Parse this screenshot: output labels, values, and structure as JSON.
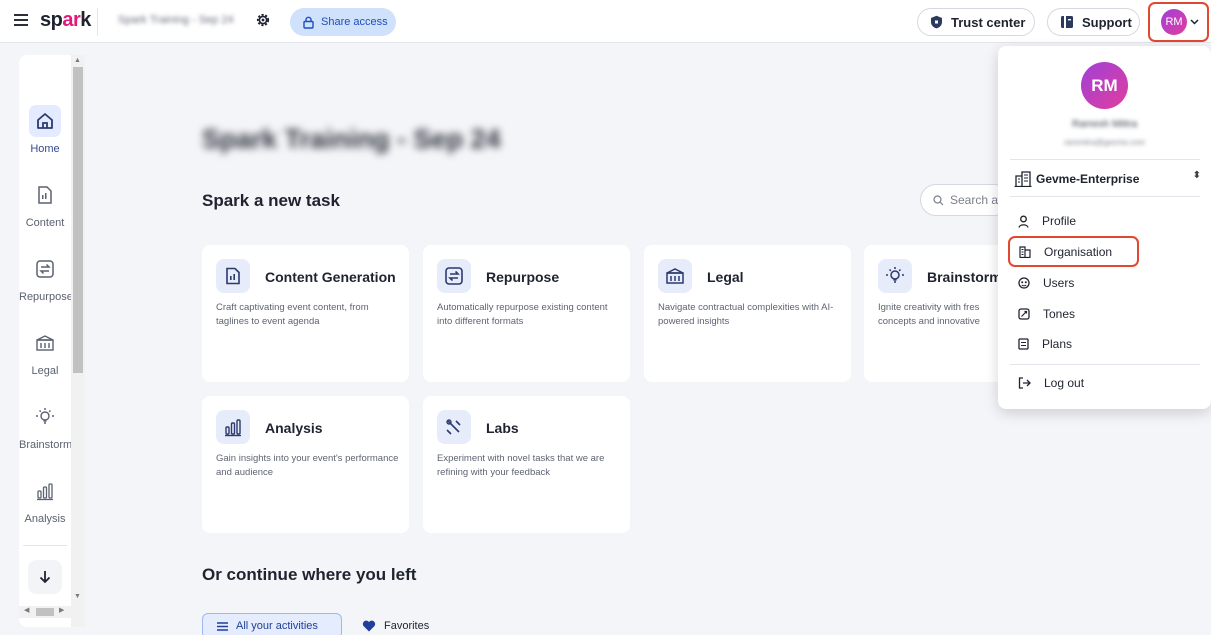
{
  "topbar": {
    "logo_a": "sp",
    "logo_b": "ar",
    "logo_c": "k",
    "project_title": "Spark Training - Sep 24",
    "share_label": "Share access",
    "trust_label": "Trust center",
    "support_label": "Support",
    "avatar_initials": "RM"
  },
  "sidebar": {
    "items": [
      {
        "label": "Home",
        "icon": "home-icon"
      },
      {
        "label": "Content",
        "icon": "document-icon"
      },
      {
        "label": "Repurpose",
        "icon": "repurpose-icon"
      },
      {
        "label": "Legal",
        "icon": "bank-icon"
      },
      {
        "label": "Brainstorm",
        "icon": "bulb-icon"
      },
      {
        "label": "Analysis",
        "icon": "bar-chart-icon"
      }
    ]
  },
  "main": {
    "page_title": "Spark Training - Sep 24",
    "new_task_heading": "Spark a new task",
    "search_placeholder": "Search a",
    "cards": [
      {
        "title": "Content Generation",
        "desc": "Craft captivating event content, from taglines to event agenda"
      },
      {
        "title": "Repurpose",
        "desc": "Automatically repurpose existing content into different formats"
      },
      {
        "title": "Legal",
        "desc": "Navigate contractual complexities with AI-powered insights"
      },
      {
        "title": "Brainstormi",
        "desc": "Ignite creativity with fres concepts and innovative"
      },
      {
        "title": "Analysis",
        "desc": "Gain insights into your event's performance and audience"
      },
      {
        "title": "Labs",
        "desc": "Experiment with novel tasks that we are refining with your feedback"
      }
    ],
    "continue_heading": "Or continue where you left",
    "tab_all": "All your activities",
    "tab_fav": "Favorites"
  },
  "dropdown": {
    "avatar_initials": "RM",
    "user_name": "Ramesh Mittra",
    "user_email": "rammitra@gevme.com",
    "org_name": "Gevme-Enterprise",
    "items": [
      {
        "label": "Profile",
        "icon": "person-icon"
      },
      {
        "label": "Organisation",
        "icon": "building-icon"
      },
      {
        "label": "Users",
        "icon": "users-icon"
      },
      {
        "label": "Tones",
        "icon": "tones-icon"
      },
      {
        "label": "Plans",
        "icon": "plans-icon"
      },
      {
        "label": "Log out",
        "icon": "logout-icon"
      }
    ]
  },
  "colors": {
    "accent": "#1f4fb8",
    "highlight_border": "#e0492f",
    "avatar_gradient_start": "#a040d8",
    "avatar_gradient_end": "#e03e9e"
  }
}
